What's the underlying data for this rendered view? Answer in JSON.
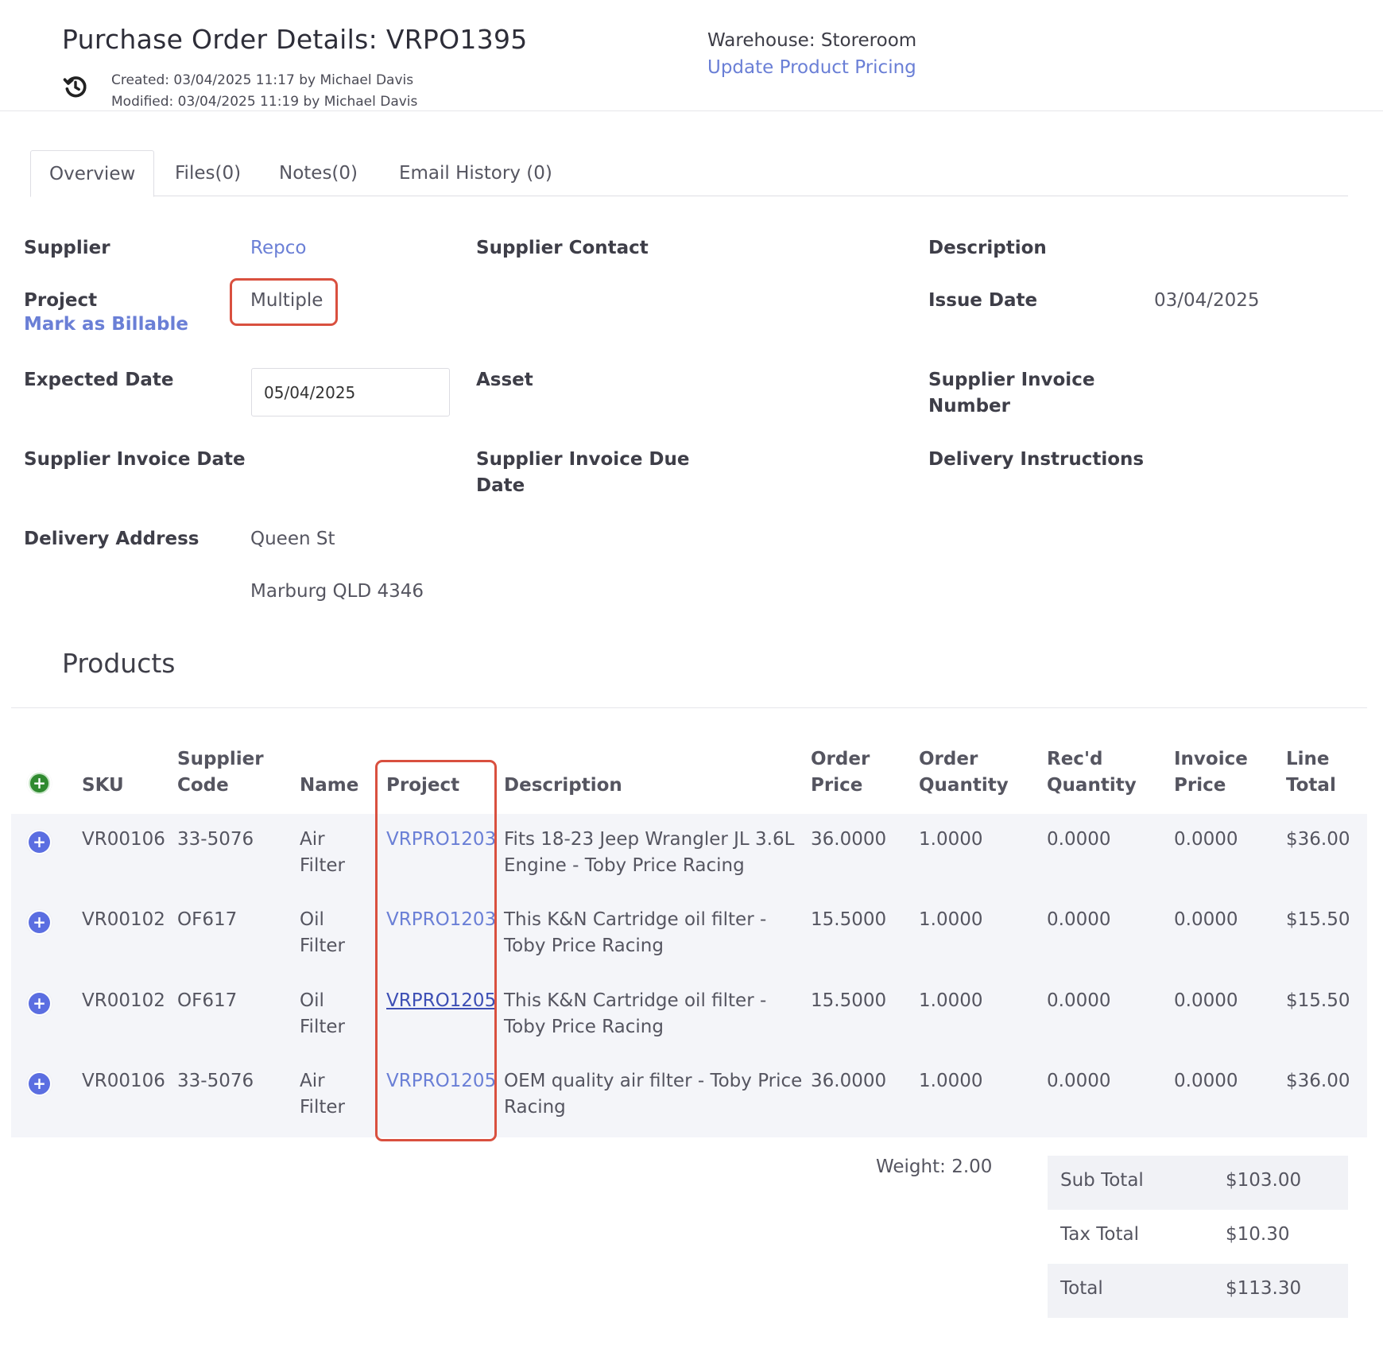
{
  "header": {
    "title": "Purchase Order Details: VRPO1395",
    "created": "Created: 03/04/2025 11:17 by Michael Davis",
    "modified": "Modified: 03/04/2025 11:19 by Michael Davis",
    "warehouse": "Warehouse: Storeroom",
    "update_pricing": "Update Product Pricing"
  },
  "tabs": [
    {
      "label": "Overview",
      "active": true
    },
    {
      "label": "Files(0)"
    },
    {
      "label": "Notes(0)"
    },
    {
      "label": "Email History (0)"
    }
  ],
  "details": {
    "supplier_label": "Supplier",
    "supplier_value": "Repco",
    "supplier_contact_label": "Supplier Contact",
    "description_label": "Description",
    "project_label": "Project",
    "project_value": "Multiple",
    "mark_billable": "Mark as Billable",
    "issue_date_label": "Issue Date",
    "issue_date_value": "03/04/2025",
    "expected_date_label": "Expected Date",
    "expected_date_value": "05/04/2025",
    "asset_label": "Asset",
    "supplier_invoice_number_label_1": "Supplier Invoice",
    "supplier_invoice_number_label_2": "Number",
    "supplier_invoice_date_label": "Supplier Invoice Date",
    "supplier_invoice_due_label_1": "Supplier Invoice Due",
    "supplier_invoice_due_label_2": "Date",
    "delivery_instructions_label": "Delivery Instructions",
    "delivery_address_label": "Delivery Address",
    "delivery_address_line1": "Queen St",
    "delivery_address_line2": "Marburg QLD 4346"
  },
  "products": {
    "title": "Products",
    "columns": {
      "sku": "SKU",
      "supplier_code_1": "Supplier",
      "supplier_code_2": "Code",
      "name": "Name",
      "project": "Project",
      "description": "Description",
      "order_price_1": "Order",
      "order_price_2": "Price",
      "order_qty_1": "Order",
      "order_qty_2": "Quantity",
      "recd_qty_1": "Rec'd",
      "recd_qty_2": "Quantity",
      "invoice_price_1": "Invoice",
      "invoice_price_2": "Price",
      "line_total_1": "Line",
      "line_total_2": "Total"
    },
    "rows": [
      {
        "sku": "VR00106",
        "supplier_code": "33-5076",
        "name_1": "Air",
        "name_2": "Filter",
        "project": "VRPRO1203",
        "desc_1": "Fits 18-23 Jeep Wrangler JL 3.6L",
        "desc_2": "Engine - Toby Price Racing",
        "order_price": "36.0000",
        "order_qty": "1.0000",
        "recd_qty": "0.0000",
        "invoice_price": "0.0000",
        "line_total": "$36.00"
      },
      {
        "sku": "VR00102",
        "supplier_code": "OF617",
        "name_1": "Oil",
        "name_2": "Filter",
        "project": "VRPRO1203",
        "desc_1": "This K&N Cartridge oil filter -",
        "desc_2": "Toby Price Racing",
        "order_price": "15.5000",
        "order_qty": "1.0000",
        "recd_qty": "0.0000",
        "invoice_price": "0.0000",
        "line_total": "$15.50"
      },
      {
        "sku": "VR00102",
        "supplier_code": "OF617",
        "name_1": "Oil",
        "name_2": "Filter",
        "project": "VRPRO1205",
        "desc_1": "This K&N Cartridge oil filter -",
        "desc_2": "Toby Price Racing",
        "order_price": "15.5000",
        "order_qty": "1.0000",
        "recd_qty": "0.0000",
        "invoice_price": "0.0000",
        "line_total": "$15.50"
      },
      {
        "sku": "VR00106",
        "supplier_code": "33-5076",
        "name_1": "Air",
        "name_2": "Filter",
        "project": "VRPRO1205",
        "desc_1": "OEM quality air filter - Toby Price",
        "desc_2": "Racing",
        "order_price": "36.0000",
        "order_qty": "1.0000",
        "recd_qty": "0.0000",
        "invoice_price": "0.0000",
        "line_total": "$36.00"
      }
    ]
  },
  "totals": {
    "weight": "Weight: 2.00",
    "sub_total_label": "Sub Total",
    "sub_total_value": "$103.00",
    "tax_total_label": "Tax Total",
    "tax_total_value": "$10.30",
    "total_label": "Total",
    "total_value": "$113.30"
  },
  "colors": {
    "link": "#6a7fd6",
    "highlight": "#d9503f",
    "add_icon": "#2f8a2f",
    "expand_icon": "#5b6ee1",
    "row_shade": "#f4f5f9"
  }
}
